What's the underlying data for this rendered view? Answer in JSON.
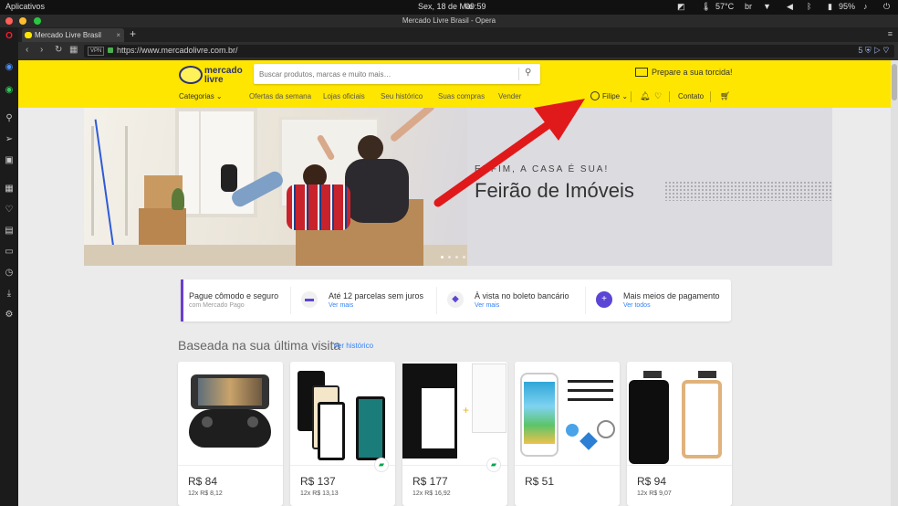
{
  "os": {
    "apps_label": "Aplicativos",
    "date": "Sex, 18 de Mai",
    "time": "09:59",
    "temp": "57°C",
    "lang": "br",
    "battery": "95%"
  },
  "browser": {
    "window_title": "Mercado Livre Brasil - Opera",
    "tab_label": "Mercado Livre Brasil",
    "new_tab": "+",
    "tab_close": "×",
    "vpn_label": "VPN",
    "url": "https://www.mercadolivre.com.br/",
    "url_badge": "5"
  },
  "header": {
    "logo_line1": "mercado",
    "logo_line2": "livre",
    "search_placeholder": "Buscar produtos, marcas e muito mais…",
    "promo": "Prepare a sua torcida!",
    "categories": "Categorias",
    "nav": [
      "Ofertas da semana",
      "Lojas oficiais",
      "Seu histórico",
      "Suas compras",
      "Vender"
    ],
    "user": "Filipe",
    "contact": "Contato"
  },
  "banner": {
    "kicker": "ENFIM, A CASA É SUA!",
    "title": "Feirão de Imóveis"
  },
  "payments": [
    {
      "title": "Pague cômodo e seguro",
      "sub": "com Mercado Pago"
    },
    {
      "title": "Até 12 parcelas sem juros",
      "sub": "Ver mais"
    },
    {
      "title": "À vista no boleto bancário",
      "sub": "Ver mais"
    },
    {
      "title": "Mais meios de pagamento",
      "sub": "Ver todos"
    }
  ],
  "history": {
    "title": "Baseada na sua última visita",
    "link": "Ver histórico",
    "items": [
      {
        "price": "R$ 84",
        "installments": "12x R$ 8,12"
      },
      {
        "price": "R$ 137",
        "installments": "12x R$ 13,13"
      },
      {
        "price": "R$ 177",
        "installments": "12x R$ 16,92"
      },
      {
        "price": "R$ 51",
        "installments": ""
      },
      {
        "price": "R$ 94",
        "installments": "12x R$ 9,07"
      }
    ]
  },
  "colors": {
    "ml_yellow": "#ffe600",
    "ml_blue": "#3483fa",
    "arrow_red": "#e0191b"
  }
}
